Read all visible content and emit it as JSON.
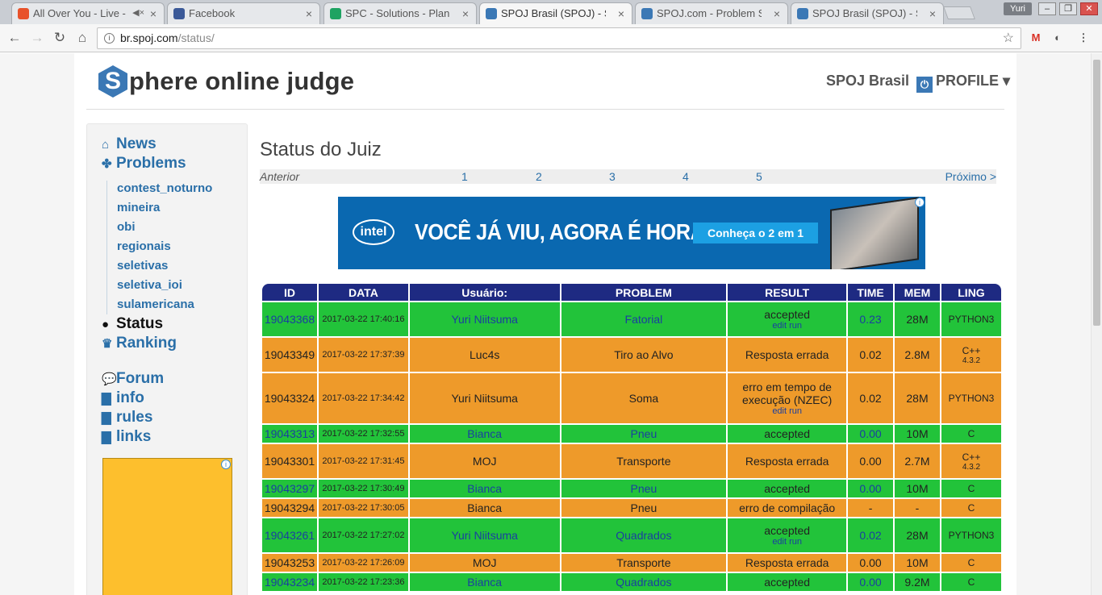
{
  "browser": {
    "tabs": [
      {
        "title": "All Over You - Live - ",
        "icon": "music-icon",
        "color": "#e8522a",
        "mute": "◀×"
      },
      {
        "title": "Facebook",
        "icon": "facebook-icon",
        "color": "#3b5998"
      },
      {
        "title": "SPC - Solutions - Planilh",
        "icon": "sheets-icon",
        "color": "#1ea362"
      },
      {
        "title": "SPOJ Brasil (SPOJ) - Stat",
        "icon": "spoj-icon",
        "color": "#3b78b5",
        "active": true
      },
      {
        "title": "SPOJ.com - Problem SO",
        "icon": "spoj-icon",
        "color": "#3b78b5"
      },
      {
        "title": "SPOJ Brasil (SPOJ) - Stat",
        "icon": "spoj-icon",
        "color": "#3b78b5"
      }
    ],
    "user": "Yuri",
    "url_host": "br.spoj.com",
    "url_path": "/status/"
  },
  "header": {
    "logo_letter": "S",
    "logo_text": "phere online judge",
    "site": "SPOJ Brasil",
    "profile": "PROFILE ▾"
  },
  "sidebar": {
    "main": [
      {
        "label": "News",
        "icon": "home-icon",
        "glyph": "⌂"
      },
      {
        "label": "Problems",
        "icon": "puzzle-icon",
        "glyph": "✤"
      }
    ],
    "sub": [
      "contest_noturno",
      "mineira",
      "obi",
      "regionais",
      "seletivas",
      "seletiva_ioi",
      "sulamericana"
    ],
    "lower": [
      {
        "label": "Status",
        "icon": "dot-icon",
        "glyph": "●",
        "active": true
      },
      {
        "label": "Ranking",
        "icon": "trophy-icon",
        "glyph": "♛"
      },
      {
        "label": "Forum",
        "icon": "chat-icon",
        "glyph": "💬"
      },
      {
        "label": "info",
        "icon": "document-icon",
        "glyph": "▇"
      },
      {
        "label": "rules",
        "icon": "document-icon",
        "glyph": "▇"
      },
      {
        "label": "links",
        "icon": "document-icon",
        "glyph": "▇"
      }
    ]
  },
  "main": {
    "title": "Status do Juiz",
    "pager": {
      "prev": "Anterior",
      "pages": [
        "1",
        "2",
        "3",
        "4",
        "5"
      ],
      "next": "Próximo >"
    },
    "banner": {
      "brand": "intel",
      "slogan": "VOCÊ JÁ VIU, AGORA É HORA DE TER.",
      "cta": "Conheça o 2 em 1"
    }
  },
  "table": {
    "headers": [
      "ID",
      "DATA",
      "Usuário:",
      "PROBLEM",
      "RESULT",
      "TIME",
      "MEM",
      "LING"
    ],
    "rows": [
      {
        "status": "ac",
        "id": "19043368",
        "date": "2017-03-22 17:40:16",
        "user": "Yuri Niitsuma",
        "problem": "Fatorial",
        "result": "accepted",
        "links": "edit  run",
        "time": "0.23",
        "mem": "28M",
        "lang": "PYTHON3",
        "ver": ""
      },
      {
        "status": "wa",
        "id": "19043349",
        "date": "2017-03-22 17:37:39",
        "user": "Luc4s",
        "problem": "Tiro ao Alvo",
        "result": "Resposta errada",
        "links": "",
        "time": "0.02",
        "mem": "2.8M",
        "lang": "C++",
        "ver": "4.3.2"
      },
      {
        "status": "wa",
        "id": "19043324",
        "date": "2017-03-22 17:34:42",
        "user": "Yuri Niitsuma",
        "problem": "Soma",
        "result": "erro em tempo de execução (NZEC)",
        "links": "edit  run",
        "time": "0.02",
        "mem": "28M",
        "lang": "PYTHON3",
        "ver": ""
      },
      {
        "status": "ac",
        "id": "19043313",
        "date": "2017-03-22 17:32:55",
        "user": "Bianca",
        "problem": "Pneu",
        "result": "accepted",
        "links": "",
        "time": "0.00",
        "mem": "10M",
        "lang": "C",
        "ver": ""
      },
      {
        "status": "wa",
        "id": "19043301",
        "date": "2017-03-22 17:31:45",
        "user": "MOJ",
        "problem": "Transporte",
        "result": "Resposta errada",
        "links": "",
        "time": "0.00",
        "mem": "2.7M",
        "lang": "C++",
        "ver": "4.3.2"
      },
      {
        "status": "ac",
        "id": "19043297",
        "date": "2017-03-22 17:30:49",
        "user": "Bianca",
        "problem": "Pneu",
        "result": "accepted",
        "links": "",
        "time": "0.00",
        "mem": "10M",
        "lang": "C",
        "ver": ""
      },
      {
        "status": "wa",
        "id": "19043294",
        "date": "2017-03-22 17:30:05",
        "user": "Bianca",
        "problem": "Pneu",
        "result": "erro de compilação",
        "links": "",
        "time": "-",
        "mem": "-",
        "lang": "C",
        "ver": ""
      },
      {
        "status": "ac",
        "id": "19043261",
        "date": "2017-03-22 17:27:02",
        "user": "Yuri Niitsuma",
        "problem": "Quadrados",
        "result": "accepted",
        "links": "edit  run",
        "time": "0.02",
        "mem": "28M",
        "lang": "PYTHON3",
        "ver": ""
      },
      {
        "status": "wa",
        "id": "19043253",
        "date": "2017-03-22 17:26:09",
        "user": "MOJ",
        "problem": "Transporte",
        "result": "Resposta errada",
        "links": "",
        "time": "0.00",
        "mem": "10M",
        "lang": "C",
        "ver": ""
      },
      {
        "status": "ac",
        "id": "19043234",
        "date": "2017-03-22 17:23:36",
        "user": "Bianca",
        "problem": "Quadrados",
        "result": "accepted",
        "links": "",
        "time": "0.00",
        "mem": "9.2M",
        "lang": "C",
        "ver": ""
      }
    ]
  }
}
